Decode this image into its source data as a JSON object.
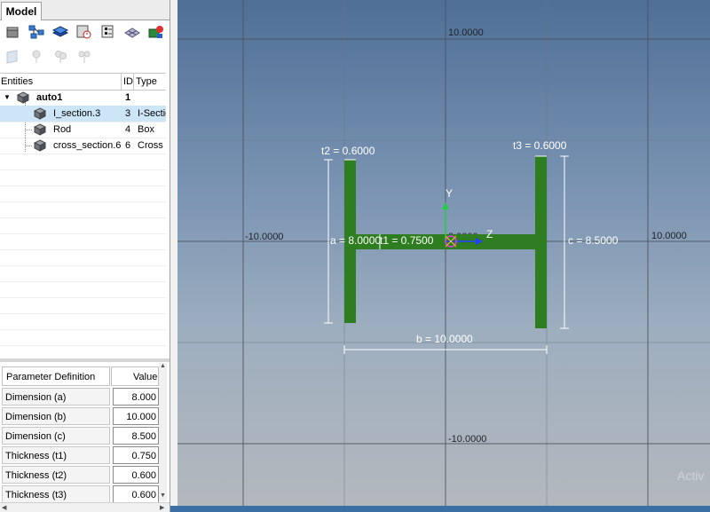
{
  "panel": {
    "tab_label": "Model",
    "toolbar_icons": [
      "box-icon",
      "network-icon",
      "layers-icon",
      "element-clock-icon",
      "config-icon",
      "mesh-icon",
      "color-icon"
    ],
    "toolbar_disabled_icons": [
      "plane-icon",
      "pin-icon",
      "pin-group-icon",
      "pin-set-icon"
    ]
  },
  "tree": {
    "columns": {
      "entities": "Entities",
      "id": "ID",
      "type": "Type"
    },
    "rows": [
      {
        "name": "auto1",
        "id": "1",
        "type": ""
      },
      {
        "name": "I_section.3",
        "id": "3",
        "type": "I-Section"
      },
      {
        "name": "Rod",
        "id": "4",
        "type": "Box"
      },
      {
        "name": "cross_section.6",
        "id": "6",
        "type": "Cross"
      }
    ]
  },
  "params": {
    "header_name": "Parameter Definition",
    "header_value": "Value",
    "rows": [
      {
        "label": "Dimension (a)",
        "value": "8.000"
      },
      {
        "label": "Dimension (b)",
        "value": "10.000"
      },
      {
        "label": "Dimension (c)",
        "value": "8.500"
      },
      {
        "label": "Thickness (t1)",
        "value": "0.750"
      },
      {
        "label": "Thickness (t2)",
        "value": "0.600"
      },
      {
        "label": "Thickness (t3)",
        "value": "0.600"
      }
    ]
  },
  "viewport": {
    "grid_labels": {
      "top": "10.0000",
      "left": "-10.0000",
      "right": "10.0000",
      "bottom": "-10.0000",
      "center": "0.0000"
    },
    "dims": {
      "t2": "t2 = 0.6000",
      "t3": "t3 = 0.6000",
      "a": "a = 8.0000",
      "t1": "t1 = 0.7500",
      "c": "c = 8.5000",
      "b": "b = 10.0000"
    },
    "axis_y": "Y",
    "axis_z": "Z",
    "watermark": "Activ",
    "section_color": "#2e7d20"
  }
}
